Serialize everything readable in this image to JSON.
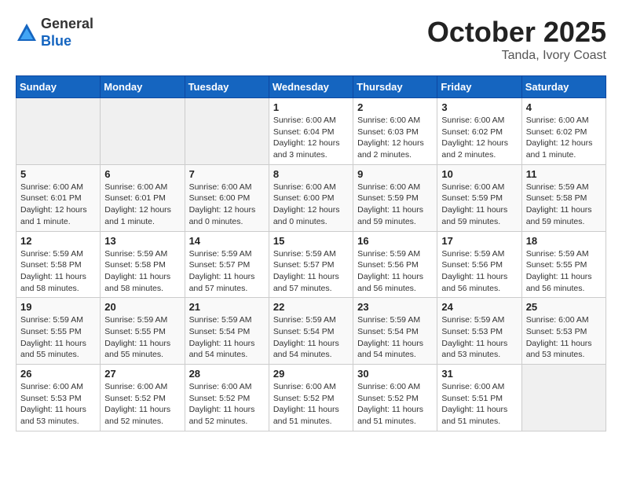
{
  "logo": {
    "general": "General",
    "blue": "Blue"
  },
  "title": "October 2025",
  "location": "Tanda, Ivory Coast",
  "days_of_week": [
    "Sunday",
    "Monday",
    "Tuesday",
    "Wednesday",
    "Thursday",
    "Friday",
    "Saturday"
  ],
  "weeks": [
    [
      {
        "num": "",
        "info": ""
      },
      {
        "num": "",
        "info": ""
      },
      {
        "num": "",
        "info": ""
      },
      {
        "num": "1",
        "info": "Sunrise: 6:00 AM\nSunset: 6:04 PM\nDaylight: 12 hours and 3 minutes."
      },
      {
        "num": "2",
        "info": "Sunrise: 6:00 AM\nSunset: 6:03 PM\nDaylight: 12 hours and 2 minutes."
      },
      {
        "num": "3",
        "info": "Sunrise: 6:00 AM\nSunset: 6:02 PM\nDaylight: 12 hours and 2 minutes."
      },
      {
        "num": "4",
        "info": "Sunrise: 6:00 AM\nSunset: 6:02 PM\nDaylight: 12 hours and 1 minute."
      }
    ],
    [
      {
        "num": "5",
        "info": "Sunrise: 6:00 AM\nSunset: 6:01 PM\nDaylight: 12 hours and 1 minute."
      },
      {
        "num": "6",
        "info": "Sunrise: 6:00 AM\nSunset: 6:01 PM\nDaylight: 12 hours and 1 minute."
      },
      {
        "num": "7",
        "info": "Sunrise: 6:00 AM\nSunset: 6:00 PM\nDaylight: 12 hours and 0 minutes."
      },
      {
        "num": "8",
        "info": "Sunrise: 6:00 AM\nSunset: 6:00 PM\nDaylight: 12 hours and 0 minutes."
      },
      {
        "num": "9",
        "info": "Sunrise: 6:00 AM\nSunset: 5:59 PM\nDaylight: 11 hours and 59 minutes."
      },
      {
        "num": "10",
        "info": "Sunrise: 6:00 AM\nSunset: 5:59 PM\nDaylight: 11 hours and 59 minutes."
      },
      {
        "num": "11",
        "info": "Sunrise: 5:59 AM\nSunset: 5:58 PM\nDaylight: 11 hours and 59 minutes."
      }
    ],
    [
      {
        "num": "12",
        "info": "Sunrise: 5:59 AM\nSunset: 5:58 PM\nDaylight: 11 hours and 58 minutes."
      },
      {
        "num": "13",
        "info": "Sunrise: 5:59 AM\nSunset: 5:58 PM\nDaylight: 11 hours and 58 minutes."
      },
      {
        "num": "14",
        "info": "Sunrise: 5:59 AM\nSunset: 5:57 PM\nDaylight: 11 hours and 57 minutes."
      },
      {
        "num": "15",
        "info": "Sunrise: 5:59 AM\nSunset: 5:57 PM\nDaylight: 11 hours and 57 minutes."
      },
      {
        "num": "16",
        "info": "Sunrise: 5:59 AM\nSunset: 5:56 PM\nDaylight: 11 hours and 56 minutes."
      },
      {
        "num": "17",
        "info": "Sunrise: 5:59 AM\nSunset: 5:56 PM\nDaylight: 11 hours and 56 minutes."
      },
      {
        "num": "18",
        "info": "Sunrise: 5:59 AM\nSunset: 5:55 PM\nDaylight: 11 hours and 56 minutes."
      }
    ],
    [
      {
        "num": "19",
        "info": "Sunrise: 5:59 AM\nSunset: 5:55 PM\nDaylight: 11 hours and 55 minutes."
      },
      {
        "num": "20",
        "info": "Sunrise: 5:59 AM\nSunset: 5:55 PM\nDaylight: 11 hours and 55 minutes."
      },
      {
        "num": "21",
        "info": "Sunrise: 5:59 AM\nSunset: 5:54 PM\nDaylight: 11 hours and 54 minutes."
      },
      {
        "num": "22",
        "info": "Sunrise: 5:59 AM\nSunset: 5:54 PM\nDaylight: 11 hours and 54 minutes."
      },
      {
        "num": "23",
        "info": "Sunrise: 5:59 AM\nSunset: 5:54 PM\nDaylight: 11 hours and 54 minutes."
      },
      {
        "num": "24",
        "info": "Sunrise: 5:59 AM\nSunset: 5:53 PM\nDaylight: 11 hours and 53 minutes."
      },
      {
        "num": "25",
        "info": "Sunrise: 6:00 AM\nSunset: 5:53 PM\nDaylight: 11 hours and 53 minutes."
      }
    ],
    [
      {
        "num": "26",
        "info": "Sunrise: 6:00 AM\nSunset: 5:53 PM\nDaylight: 11 hours and 53 minutes."
      },
      {
        "num": "27",
        "info": "Sunrise: 6:00 AM\nSunset: 5:52 PM\nDaylight: 11 hours and 52 minutes."
      },
      {
        "num": "28",
        "info": "Sunrise: 6:00 AM\nSunset: 5:52 PM\nDaylight: 11 hours and 52 minutes."
      },
      {
        "num": "29",
        "info": "Sunrise: 6:00 AM\nSunset: 5:52 PM\nDaylight: 11 hours and 51 minutes."
      },
      {
        "num": "30",
        "info": "Sunrise: 6:00 AM\nSunset: 5:52 PM\nDaylight: 11 hours and 51 minutes."
      },
      {
        "num": "31",
        "info": "Sunrise: 6:00 AM\nSunset: 5:51 PM\nDaylight: 11 hours and 51 minutes."
      },
      {
        "num": "",
        "info": ""
      }
    ]
  ]
}
